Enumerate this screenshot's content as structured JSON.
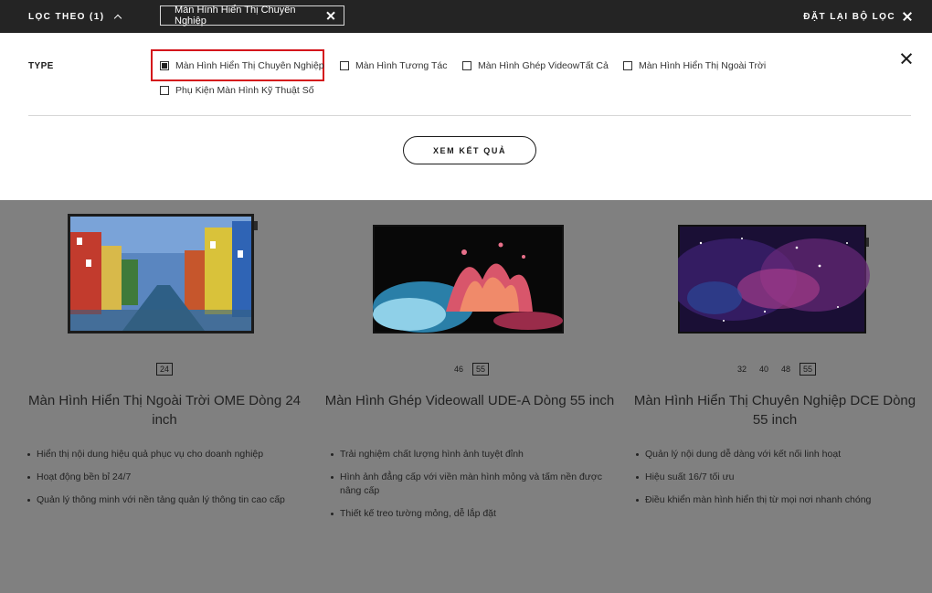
{
  "topbar": {
    "filter_label": "LỌC THEO (1)",
    "active_chip": "Màn Hình Hiển Thị Chuyên Nghiệp",
    "reset_label": "ĐẶT LẠI BỘ LỌC"
  },
  "filter_panel": {
    "type_label": "TYPE",
    "options": [
      {
        "label": "Màn Hình Hiển Thị Chuyên Nghiệp",
        "checked": true
      },
      {
        "label": "Màn Hình Tương Tác",
        "checked": false
      },
      {
        "label": "Màn Hình Ghép VideowTất Cả",
        "checked": false
      },
      {
        "label": "Màn Hình Hiển Thị Ngoài Trời",
        "checked": false
      },
      {
        "label": "Phụ Kiện Màn Hình Kỹ Thuật Số",
        "checked": false
      }
    ],
    "results_button": "XEM KẾT QUẢ"
  },
  "products": [
    {
      "sizes": [
        "24"
      ],
      "active_size": "24",
      "name": "Màn Hình Hiển Thị Ngoài Trời OME Dòng 24 inch",
      "features": [
        "Hiển thị nội dung hiệu quả phục vụ cho doanh nghiệp",
        "Hoạt động bền bỉ 24/7",
        "Quản lý thông minh với nền tảng quản lý thông tin cao cấp"
      ]
    },
    {
      "sizes": [
        "46",
        "55"
      ],
      "active_size": "55",
      "name": "Màn Hình Ghép Videowall UDE-A Dòng 55 inch",
      "features": [
        "Trải nghiệm chất lượng hình ảnh tuyệt đỉnh",
        "Hình ảnh đẳng cấp với viền màn hình mỏng và tấm nền được nâng cấp",
        "Thiết kế treo tường mỏng, dễ lắp đặt"
      ]
    },
    {
      "sizes": [
        "32",
        "40",
        "48",
        "55"
      ],
      "active_size": "55",
      "name": "Màn Hình Hiển Thị Chuyên Nghiệp DCE Dòng 55 inch",
      "features": [
        "Quản lý nội dung dễ dàng với kết nối linh hoạt",
        "Hiệu suất 16/7 tối ưu",
        "Điều khiển màn hình hiển thị từ mọi nơi nhanh chóng"
      ]
    }
  ]
}
